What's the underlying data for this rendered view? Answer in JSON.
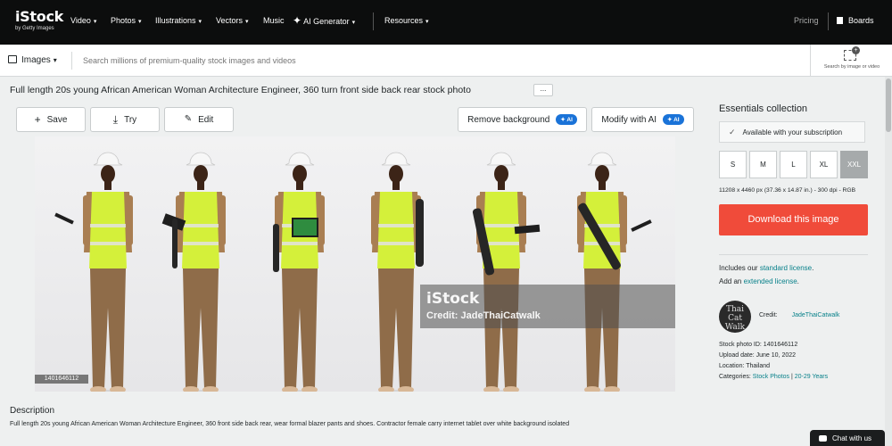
{
  "nav": {
    "logo": "iStock",
    "logo_sub": "by Getty Images",
    "items": [
      {
        "label": "Video",
        "chevron": true
      },
      {
        "label": "Photos",
        "chevron": true
      },
      {
        "label": "Illustrations",
        "chevron": true
      },
      {
        "label": "Vectors",
        "chevron": true
      },
      {
        "label": "Music",
        "chevron": false
      },
      {
        "label": "AI Generator",
        "chevron": true
      },
      {
        "label": "Resources",
        "chevron": true
      }
    ],
    "pricing": "Pricing",
    "boards": "Boards"
  },
  "search": {
    "media_type": "Images",
    "placeholder": "Search millions of premium-quality stock images and videos",
    "search_by_image": "Search by image or video"
  },
  "asset": {
    "title": "Full length 20s young African American Woman Architecture Engineer, 360 turn front side back rear stock photo",
    "more": "...",
    "id_badge": "1401646112",
    "watermark_brand": "iStock",
    "watermark_credit": "Credit: JadeThaiCatwalk"
  },
  "actions": {
    "save": "Save",
    "try": "Try",
    "edit": "Edit",
    "remove_bg": "Remove background",
    "modify_ai": "Modify with AI",
    "ai_badge": "AI"
  },
  "description": {
    "heading": "Description",
    "text": "Full length 20s young African American Woman Architecture Engineer, 360 front side back rear, wear formal blazer pants and shoes. Contractor female carry internet tablet over white background isolated"
  },
  "panel": {
    "collection": "Essentials collection",
    "availability": "Available with your subscription",
    "sizes": [
      "S",
      "M",
      "L",
      "XL",
      "XXL"
    ],
    "selected_size": "XXL",
    "dimensions": "11208 x 4460 px (37.36 x 14.87 in.) - 300 dpi - RGB",
    "download": "Download this image",
    "license_1_prefix": "Includes our",
    "license_1_link": "standard license",
    "license_1_suffix": ".",
    "license_2_prefix": "Add an",
    "license_2_link": "extended license",
    "license_2_suffix": ".",
    "avatar_text": "Thai Cat Walk",
    "credit_label": "Credit:",
    "credit_name": "JadeThaiCatwalk",
    "photo_id": "Stock photo ID: 1401646112",
    "upload_date": "Upload date: June 10, 2022",
    "location": "Location: Thailand",
    "categories_label": "Categories:",
    "category_1": "Stock Photos",
    "category_sep": "|",
    "category_2": "20-29 Years"
  },
  "chat": "Chat with us",
  "colors": {
    "nav_bg": "#0c0d0d",
    "download": "#f04b3a",
    "link": "#08818a",
    "ai_badge": "#1a73d8",
    "vest": "#d4f03a",
    "blazer": "#a97e52"
  },
  "icons": [
    "image-icon",
    "search-by-image-icon",
    "plus-icon",
    "download-icon",
    "edit-icon",
    "sparkle-icon",
    "check-icon",
    "boards-icon",
    "chat-icon"
  ]
}
